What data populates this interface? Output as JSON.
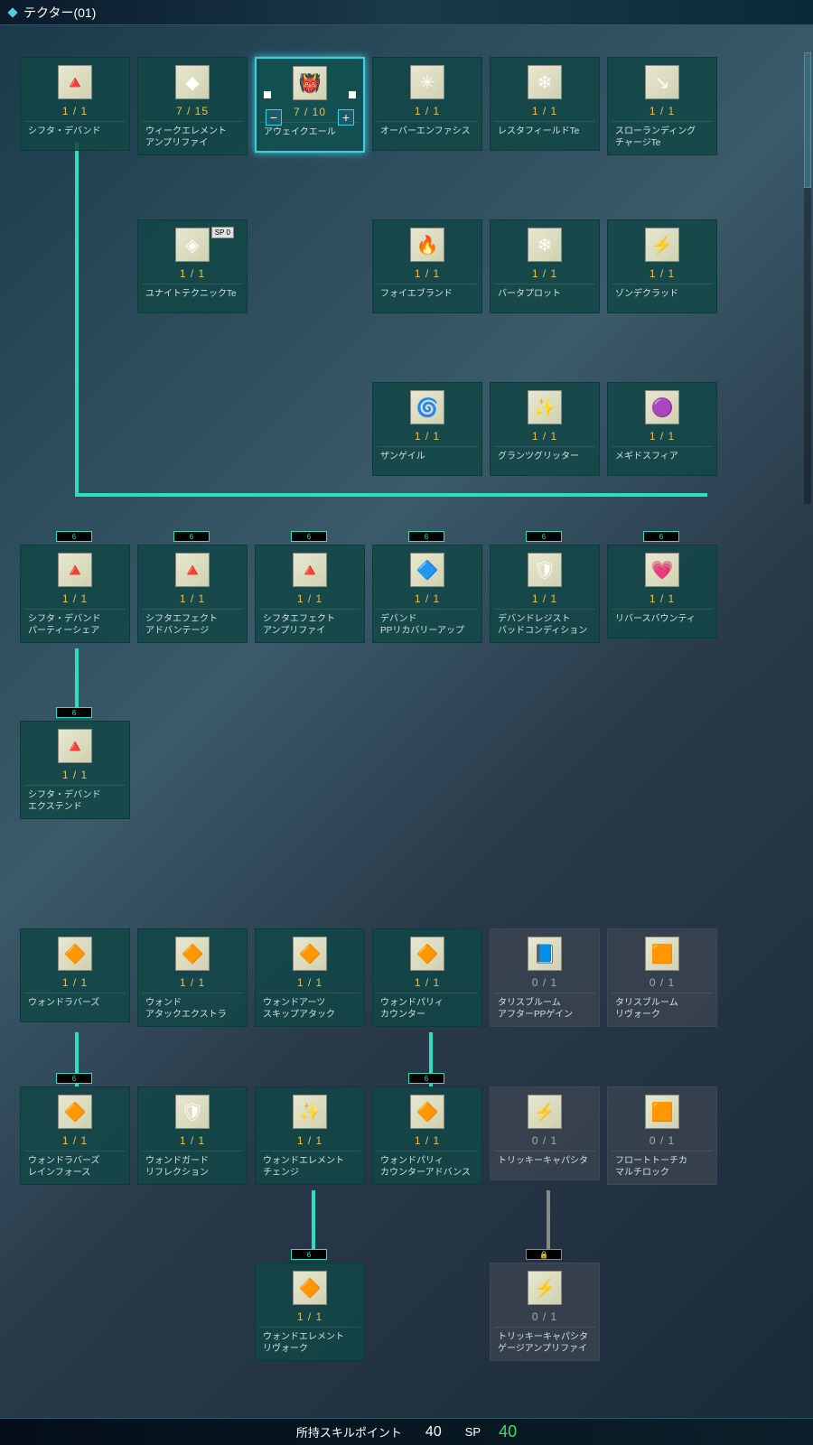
{
  "header": {
    "title": "テクター(01)"
  },
  "footer": {
    "owned_label": "所持スキルポイント",
    "owned_value": "40",
    "sp_label": "SP",
    "sp_value": "40"
  },
  "badges": {
    "sp0": "SP 0",
    "lv": "6",
    "lock": "🔒"
  },
  "buttons": {
    "minus": "−",
    "plus": "+"
  },
  "skills": {
    "r1c1": {
      "pts": "1 / 1",
      "name": "シフタ・デバンド",
      "glyph": "🔺"
    },
    "r1c2": {
      "pts": "7 / 15",
      "name": "ウィークエレメント\nアンプリファイ",
      "glyph": "◆"
    },
    "r1c3": {
      "pts": "7 / 10",
      "name": "アウェイクエール",
      "glyph": "👹"
    },
    "r1c4": {
      "pts": "1 / 1",
      "name": "オーバーエンファシス",
      "glyph": "✳"
    },
    "r1c5": {
      "pts": "1 / 1",
      "name": "レスタフィールドTe",
      "glyph": "❄"
    },
    "r1c6": {
      "pts": "1 / 1",
      "name": "スローランディング\nチャージTe",
      "glyph": "↘"
    },
    "r2c2": {
      "pts": "1 / 1",
      "name": "ユナイトテクニックTe",
      "glyph": "◈"
    },
    "r2c4": {
      "pts": "1 / 1",
      "name": "フォイエブランド",
      "glyph": "🔥"
    },
    "r2c5": {
      "pts": "1 / 1",
      "name": "バータプロット",
      "glyph": "❄"
    },
    "r2c6": {
      "pts": "1 / 1",
      "name": "ゾンデクラッド",
      "glyph": "⚡"
    },
    "r3c4": {
      "pts": "1 / 1",
      "name": "ザンゲイル",
      "glyph": "🌀"
    },
    "r3c5": {
      "pts": "1 / 1",
      "name": "グランツグリッター",
      "glyph": "✨"
    },
    "r3c6": {
      "pts": "1 / 1",
      "name": "メギドスフィア",
      "glyph": "🟣"
    },
    "r4c1": {
      "pts": "1 / 1",
      "name": "シフタ・デバンド\nパーティーシェア",
      "glyph": "🔺"
    },
    "r4c2": {
      "pts": "1 / 1",
      "name": "シフタエフェクト\nアドバンテージ",
      "glyph": "🔺"
    },
    "r4c3": {
      "pts": "1 / 1",
      "name": "シフタエフェクト\nアンプリファイ",
      "glyph": "🔺"
    },
    "r4c4": {
      "pts": "1 / 1",
      "name": "デバンド\nPPリカバリーアップ",
      "glyph": "🔷"
    },
    "r4c5": {
      "pts": "1 / 1",
      "name": "デバンドレジスト\nバッドコンディション",
      "glyph": "🛡"
    },
    "r4c6": {
      "pts": "1 / 1",
      "name": "リバースバウンティ",
      "glyph": "💗"
    },
    "r5c1": {
      "pts": "1 / 1",
      "name": "シフタ・デバンド\nエクステンド",
      "glyph": "🔺"
    },
    "r6c1": {
      "pts": "1 / 1",
      "name": "ウォンドラバーズ",
      "glyph": "🔶"
    },
    "r6c2": {
      "pts": "1 / 1",
      "name": "ウォンド\nアタックエクストラ",
      "glyph": "🔶"
    },
    "r6c3": {
      "pts": "1 / 1",
      "name": "ウォンドアーツ\nスキップアタック",
      "glyph": "🔶"
    },
    "r6c4": {
      "pts": "1 / 1",
      "name": "ウォンドパリィ\nカウンター",
      "glyph": "🔶"
    },
    "r6c5": {
      "pts": "0 / 1",
      "name": "タリスブルーム\nアフターPPゲイン",
      "glyph": "📘"
    },
    "r6c6": {
      "pts": "0 / 1",
      "name": "タリスブルーム\nリヴォーク",
      "glyph": "🟧"
    },
    "r7c1": {
      "pts": "1 / 1",
      "name": "ウォンドラバーズ\nレインフォース",
      "glyph": "🔶"
    },
    "r7c2": {
      "pts": "1 / 1",
      "name": "ウォンドガード\nリフレクション",
      "glyph": "🛡"
    },
    "r7c3": {
      "pts": "1 / 1",
      "name": "ウォンドエレメント\nチェンジ",
      "glyph": "✨"
    },
    "r7c4": {
      "pts": "1 / 1",
      "name": "ウォンドパリィ\nカウンターアドバンス",
      "glyph": "🔶"
    },
    "r7c5": {
      "pts": "0 / 1",
      "name": "トリッキーキャパシタ",
      "glyph": "⚡"
    },
    "r7c6": {
      "pts": "0 / 1",
      "name": "フロートトーチカ\nマルチロック",
      "glyph": "🟧"
    },
    "r8c3": {
      "pts": "1 / 1",
      "name": "ウォンドエレメント\nリヴォーク",
      "glyph": "🔶"
    },
    "r8c5": {
      "pts": "0 / 1",
      "name": "トリッキーキャパシタ\nゲージアンプリファイ",
      "glyph": "⚡"
    }
  }
}
